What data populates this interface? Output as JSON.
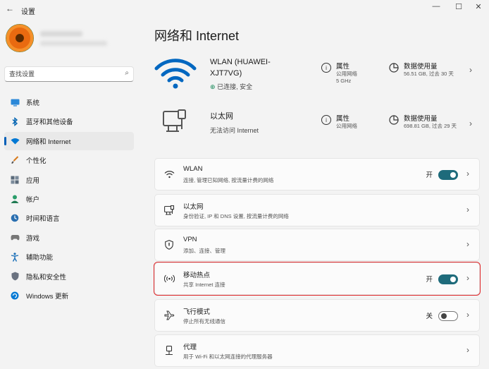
{
  "window": {
    "title": "设置",
    "back_glyph": "←",
    "min_glyph": "—",
    "max_glyph": "☐",
    "close_glyph": "✕"
  },
  "search": {
    "placeholder": "查找设置",
    "icon": "search-icon"
  },
  "sidebar": {
    "items": [
      {
        "label": "系统",
        "icon": "monitor-icon",
        "color": "#0078d4",
        "active": false
      },
      {
        "label": "蓝牙和其他设备",
        "icon": "bluetooth-icon",
        "color": "#0063b1",
        "active": false
      },
      {
        "label": "网络和 Internet",
        "icon": "wifi-icon",
        "color": "#0078d4",
        "active": true
      },
      {
        "label": "个性化",
        "icon": "brush-icon",
        "color": "#d87a1c",
        "active": false
      },
      {
        "label": "应用",
        "icon": "apps-icon",
        "color": "#5a6a7a",
        "active": false
      },
      {
        "label": "帐户",
        "icon": "person-icon",
        "color": "#2a9d6a",
        "active": false
      },
      {
        "label": "时间和语言",
        "icon": "globe-clock-icon",
        "color": "#2a6fb0",
        "active": false
      },
      {
        "label": "游戏",
        "icon": "gamepad-icon",
        "color": "#666666",
        "active": false
      },
      {
        "label": "辅助功能",
        "icon": "accessibility-icon",
        "color": "#1a6fb8",
        "active": false
      },
      {
        "label": "隐私和安全性",
        "icon": "shield-icon",
        "color": "#6a7280",
        "active": false
      },
      {
        "label": "Windows 更新",
        "icon": "update-icon",
        "color": "#0078d4",
        "active": false
      }
    ]
  },
  "main": {
    "title": "网络和 Internet",
    "wlan_hero": {
      "name": "WLAN (HUAWEI-XJT7VG)",
      "status": "已连接, 安全",
      "props": {
        "title": "属性",
        "line1": "公用网络",
        "line2": "5 GHz"
      },
      "usage": {
        "title": "数据使用量",
        "line1": "56.51 GB, 过去 30 天"
      }
    },
    "ethernet_hero": {
      "name": "以太网",
      "status": "无法访问 Internet",
      "props": {
        "title": "属性",
        "line1": "公用网络"
      },
      "usage": {
        "title": "数据使用量",
        "line1": "698.81 GB, 过去 29 天"
      }
    },
    "cards": [
      {
        "id": "wlan",
        "title": "WLAN",
        "desc": "连接, 管理已知网络, 按流量计费的网络",
        "icon": "wifi-icon",
        "toggle": "on",
        "toggle_label": "开"
      },
      {
        "id": "ethernet",
        "title": "以太网",
        "desc": "身份验证, IP 和 DNS 设置, 按流量计费的网络",
        "icon": "ethernet-icon"
      },
      {
        "id": "vpn",
        "title": "VPN",
        "desc": "添加、连接、管理",
        "icon": "vpn-shield-icon"
      },
      {
        "id": "hotspot",
        "title": "移动热点",
        "desc": "共享 Internet 连接",
        "icon": "hotspot-icon",
        "toggle": "on",
        "toggle_label": "开",
        "highlight": true
      },
      {
        "id": "airplane",
        "title": "飞行模式",
        "desc": "停止所有无线通信",
        "icon": "airplane-icon",
        "toggle": "off",
        "toggle_label": "关"
      },
      {
        "id": "proxy",
        "title": "代理",
        "desc": "用于 Wi-Fi 和以太网连接的代理服务器",
        "icon": "proxy-icon"
      }
    ]
  },
  "colors": {
    "accent": "#005fb8",
    "toggle_on": "#1e6b7b",
    "highlight": "#e0272a",
    "wifi_hero": "#0067c0"
  }
}
